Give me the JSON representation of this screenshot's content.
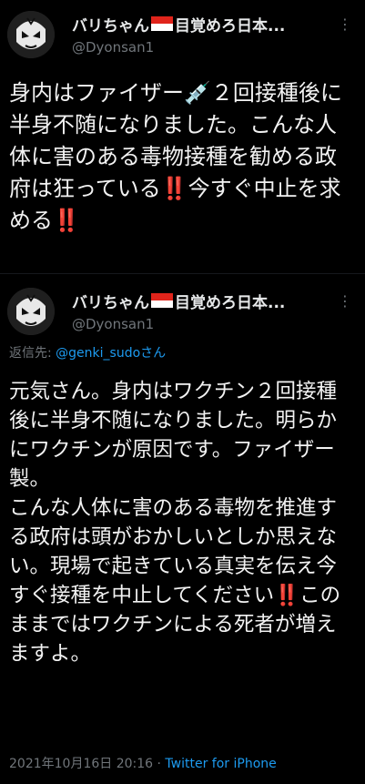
{
  "tweets": [
    {
      "display_name": "バリちゃん",
      "name_suffix": "目覚めろ日本...",
      "handle": "@Dyonsan1",
      "more_icon": "more-dots-icon",
      "text": "身内はファイザー💉２回接種後に半身不随になりました。こんな人体に害のある毒物接種を勧める政府は狂っている‼️今すぐ中止を求める‼️"
    },
    {
      "display_name": "バリちゃん",
      "name_suffix": "目覚めろ日本...",
      "handle": "@Dyonsan1",
      "reply_prefix": "返信先: ",
      "reply_mention": "@genki_sudo",
      "reply_suffix": "さん",
      "text": "元気さん。身内はワクチン２回接種後に半身不随になりました。明らかにワクチンが原因です。ファイザー製。\nこんな人体に害のある毒物を推進する政府は頭がおかしいとしか思えない。現場で起きている真実を伝え今すぐ接種を中止してください‼️このままではワクチンによる死者が増えますよ。",
      "timestamp": "2021年10月16日 20:16",
      "separator": " · ",
      "source": "Twitter for iPhone"
    }
  ],
  "colors": {
    "background": "#000000",
    "text": "#e7e9ea",
    "secondary": "#71767b",
    "link": "#1d9bf0"
  }
}
